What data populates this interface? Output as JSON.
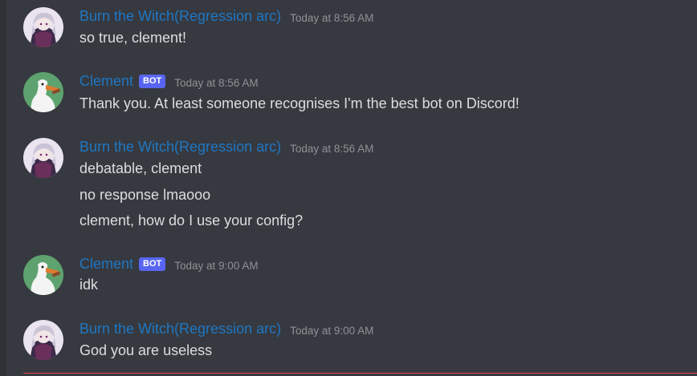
{
  "messages": [
    {
      "author": "Burn the Witch(Regression arc)",
      "avatar_icon": "anime-girl-avatar-icon",
      "timestamp": "Today at 8:56 AM",
      "lines": [
        "so true, clement!"
      ]
    },
    {
      "author": "Clement",
      "avatar_icon": "goose-avatar-icon",
      "badge": "BOT",
      "timestamp": "Today at 8:56 AM",
      "lines": [
        "Thank you. At least someone recognises I'm the best bot on Discord!"
      ]
    },
    {
      "author": "Burn the Witch(Regression arc)",
      "avatar_icon": "anime-girl-avatar-icon",
      "timestamp": "Today at 8:56 AM",
      "lines": [
        "debatable, clement",
        "no response lmaooo",
        "clement, how do I use your config?"
      ]
    },
    {
      "author": "Clement",
      "avatar_icon": "goose-avatar-icon",
      "badge": "BOT",
      "timestamp": "Today at 9:00 AM",
      "lines": [
        "idk"
      ]
    },
    {
      "author": "Burn the Witch(Regression arc)",
      "avatar_icon": "anime-girl-avatar-icon",
      "timestamp": "Today at 9:00 AM",
      "lines": [
        "God you are useless"
      ]
    }
  ],
  "colors": {
    "background": "#36393f",
    "username": "#1f77c4",
    "message_text": "#dcddde",
    "timestamp": "#8e9297",
    "bot_badge": "#5865f2",
    "new_messages_divider": "#ed4245"
  }
}
